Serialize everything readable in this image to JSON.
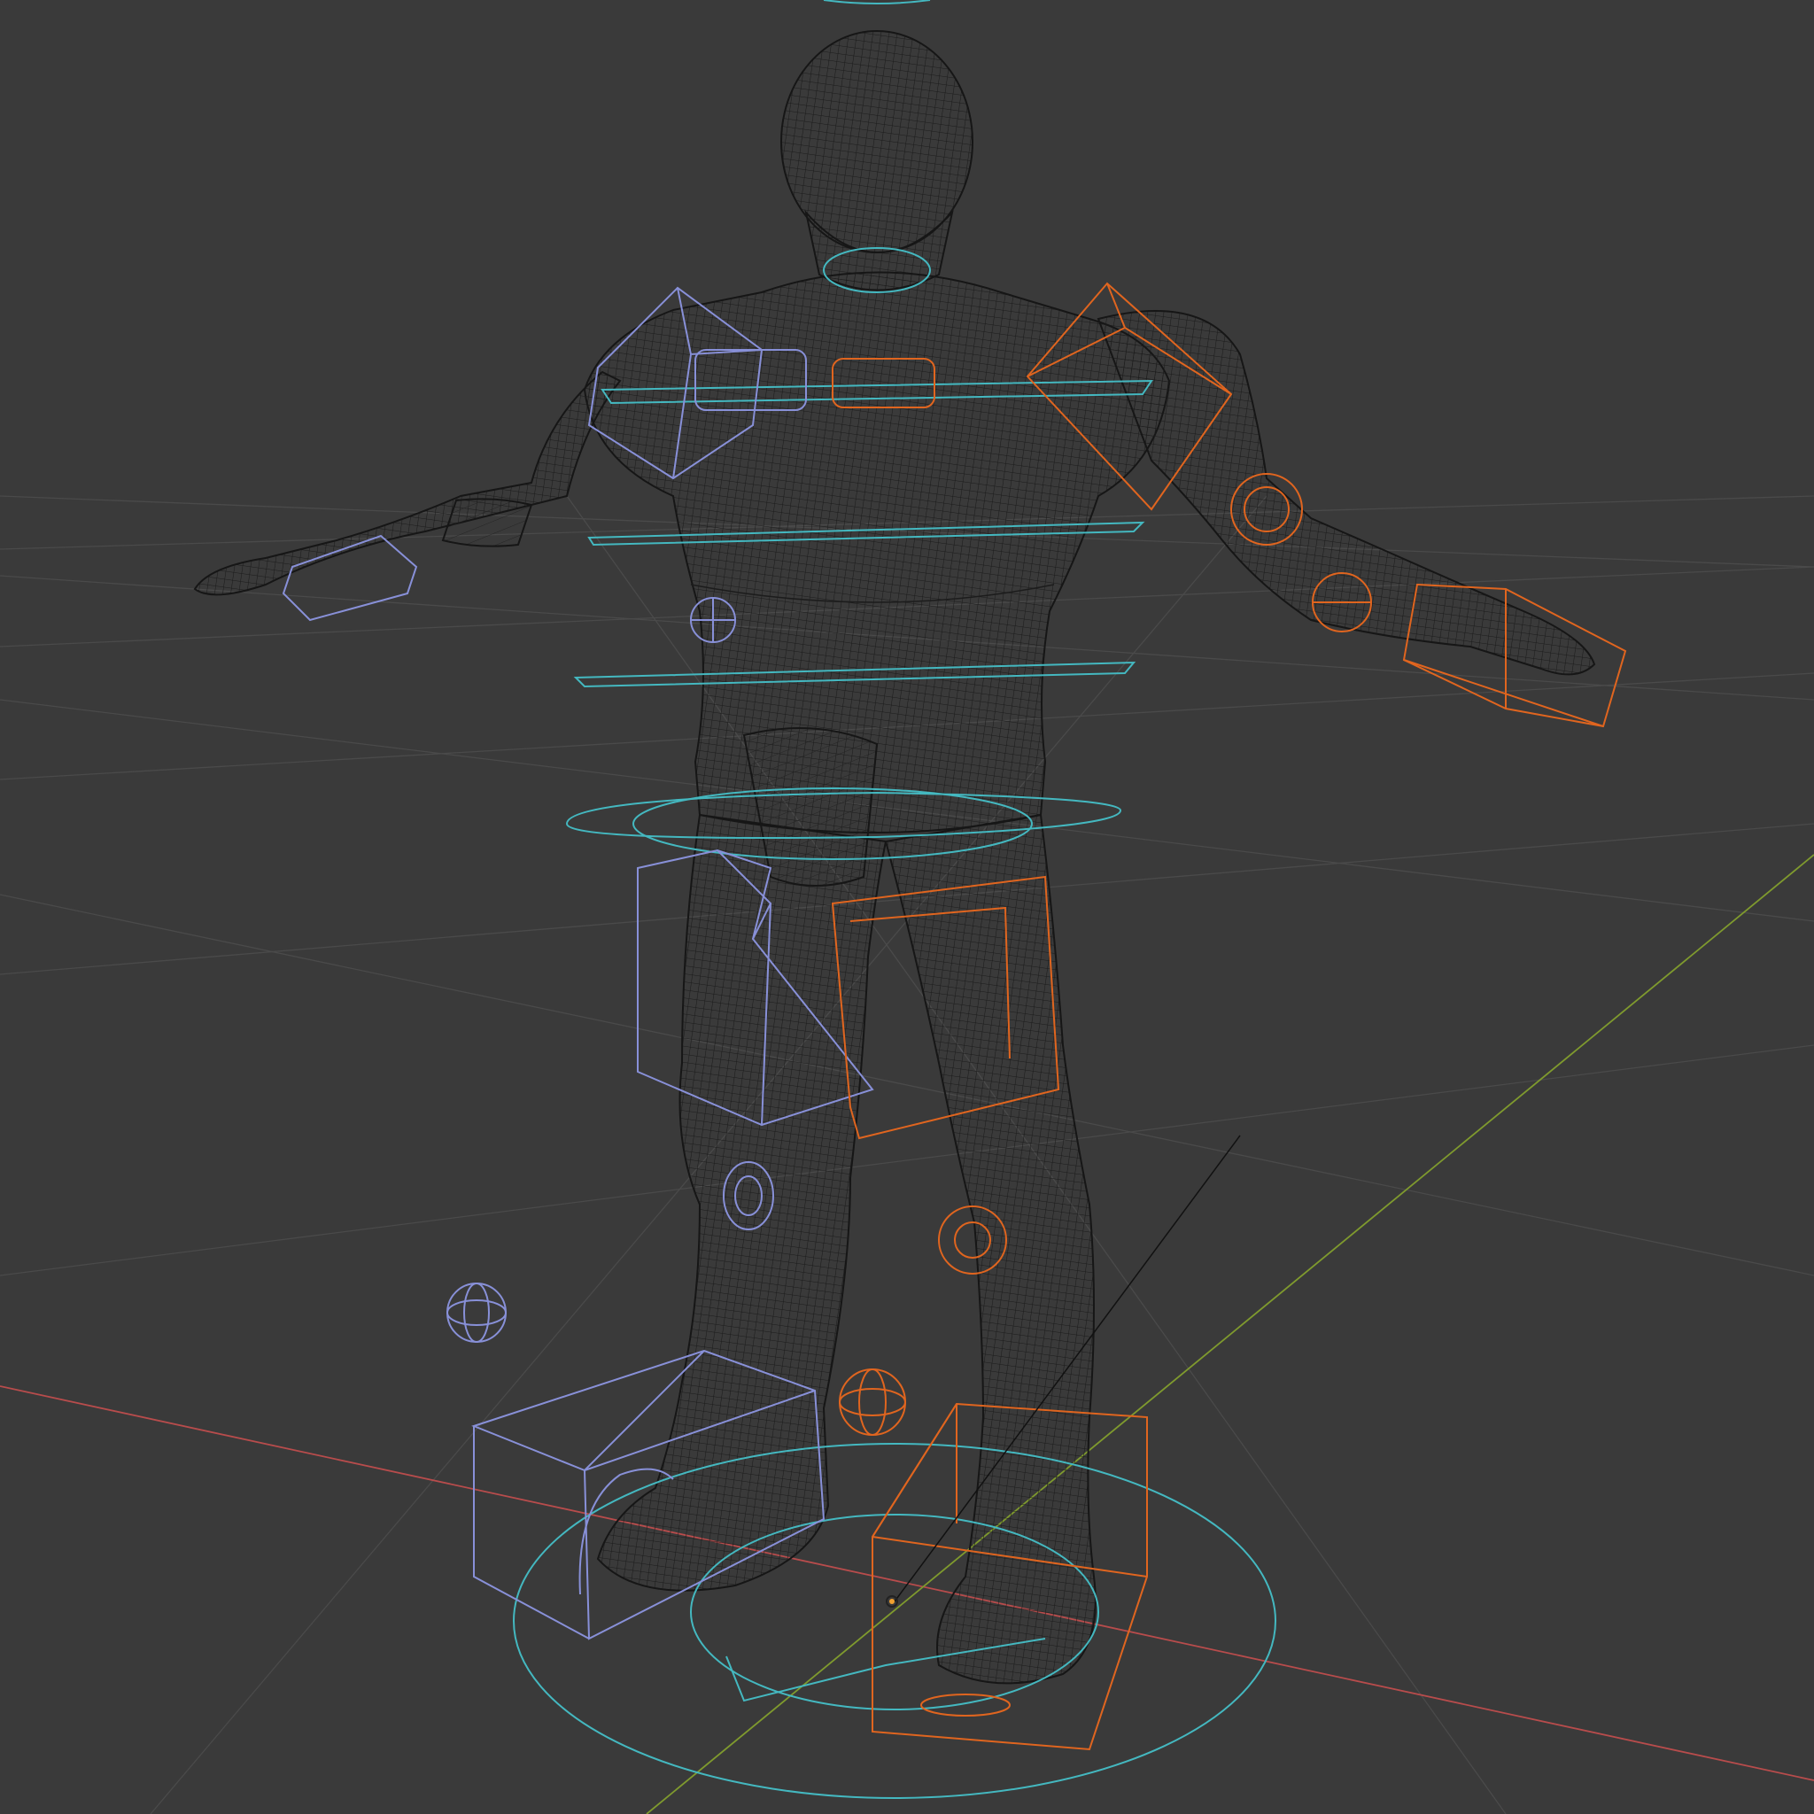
{
  "viewport": {
    "shading": "wireframe",
    "colors": {
      "background": "#3a3a3a",
      "grid": "#4a4a4a",
      "axis_x": "#b84c4c",
      "axis_y": "#7f9a2e",
      "mesh": "#1b1b1b",
      "control_center": "#44b8c0",
      "control_left": "#8890d8",
      "control_right": "#e0651f",
      "selected_origin": "#f0a030"
    },
    "objects": {
      "mesh": "humanoid-character-mesh",
      "rig": "character-control-rig",
      "origin": "object-origin-point"
    }
  }
}
